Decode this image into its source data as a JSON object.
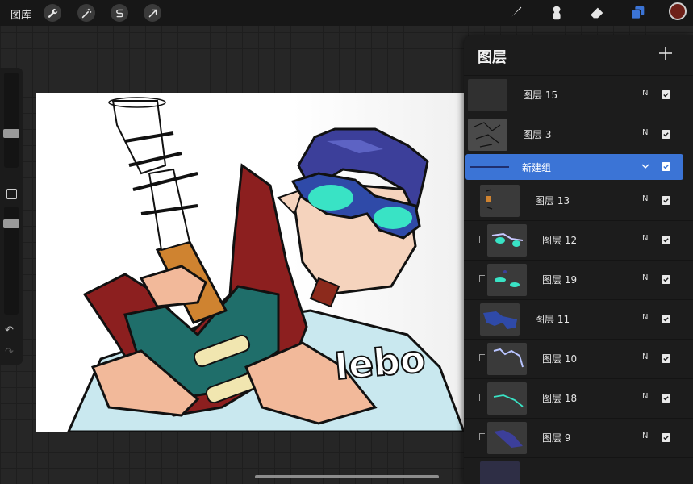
{
  "topbar": {
    "gallery_label": "图库",
    "left_tools": [
      "wrench-icon",
      "magic-wand-icon",
      "selection-s-icon",
      "transform-arrow-icon"
    ],
    "right_tools": [
      "brush-icon",
      "smudge-icon",
      "eraser-icon",
      "layers-icon"
    ],
    "active_color": "#6e2018",
    "accent": "#3b74d6"
  },
  "layers_panel": {
    "title": "图层",
    "add_label": "+",
    "group": {
      "name": "新建组",
      "visible": true
    },
    "layers": [
      {
        "name": "图层 15",
        "blend": "N",
        "visible": true,
        "clipped": false
      },
      {
        "name": "图层 3",
        "blend": "N",
        "visible": true,
        "clipped": false
      },
      {
        "name": "图层 13",
        "blend": "N",
        "visible": true,
        "clipped": false
      },
      {
        "name": "图层 12",
        "blend": "N",
        "visible": true,
        "clipped": true
      },
      {
        "name": "图层 19",
        "blend": "N",
        "visible": true,
        "clipped": true
      },
      {
        "name": "图层 11",
        "blend": "N",
        "visible": true,
        "clipped": false
      },
      {
        "name": "图层 10",
        "blend": "N",
        "visible": true,
        "clipped": true
      },
      {
        "name": "图层 18",
        "blend": "N",
        "visible": true,
        "clipped": true
      },
      {
        "name": "图层 9",
        "blend": "N",
        "visible": true,
        "clipped": true
      }
    ]
  },
  "canvas": {
    "artwork_text": "Iebo"
  }
}
